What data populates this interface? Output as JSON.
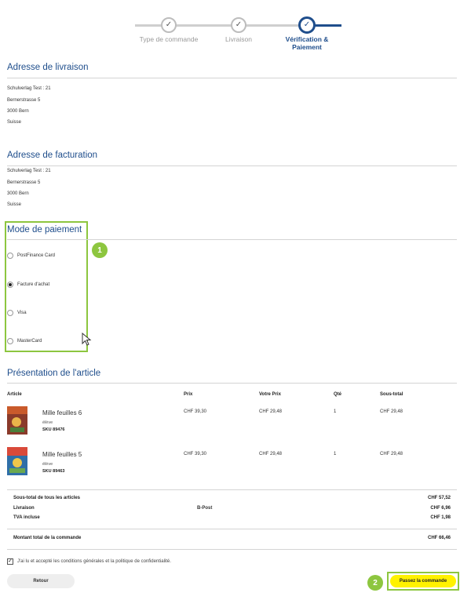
{
  "stepper": {
    "steps": [
      {
        "label": "Type de commande"
      },
      {
        "label": "Livraison"
      },
      {
        "label": "Vérification &",
        "label2": "Paiement"
      }
    ]
  },
  "shipping": {
    "title": "Adresse de livraison",
    "lines": [
      "Schulverlag Test : 21",
      "Bernerstrasse 5",
      "3000 Bern",
      "Suisse"
    ]
  },
  "billing": {
    "title": "Adresse de facturation",
    "lines": [
      "Schulverlag Test : 21",
      "Bernerstrasse 5",
      "3000 Bern",
      "Suisse"
    ]
  },
  "payment": {
    "title": "Mode de paiement",
    "badge": "1",
    "options": [
      {
        "label": "PostFinance Card",
        "checked": false
      },
      {
        "label": "Facture d'achat",
        "checked": true
      },
      {
        "label": "Visa",
        "checked": false
      },
      {
        "label": "MasterCard",
        "checked": false
      }
    ]
  },
  "articles": {
    "title": "Présentation de l'article",
    "headers": {
      "article": "Article",
      "price": "Prix",
      "your_price": "Votre Prix",
      "qty": "Qté",
      "subtotal": "Sous-total"
    },
    "items": [
      {
        "name": "Mille feuilles 6",
        "sub": "élève",
        "sku": "SKU 89476",
        "price": "CHF 39,30",
        "your_price": "CHF 29,48",
        "qty": "1",
        "subtotal": "CHF 29,48"
      },
      {
        "name": "Mille feuilles 5",
        "sub": "élève",
        "sku": "SKU 89463",
        "price": "CHF 39,30",
        "your_price": "CHF 29,48",
        "qty": "1",
        "subtotal": "CHF 29,48"
      }
    ]
  },
  "summary": {
    "subtotal_label": "Sous-total de tous les articles",
    "subtotal_value": "CHF 57,52",
    "shipping_label": "Livraison",
    "shipping_method": "B-Post",
    "shipping_value": "CHF 6,96",
    "vat_label": "TVA incluse",
    "vat_value": "CHF 1,98",
    "total_label": "Montant total de la commande",
    "total_value": "CHF 66,46"
  },
  "terms": {
    "label": "J'ai lu et accepté les conditions générales et la politique de confidentialité.",
    "checked": true
  },
  "actions": {
    "back": "Retour",
    "order": "Passez la commande",
    "badge": "2"
  },
  "colors": {
    "accent": "#1f4e8c",
    "highlight": "#8dc63f",
    "order_button": "#fff200"
  }
}
